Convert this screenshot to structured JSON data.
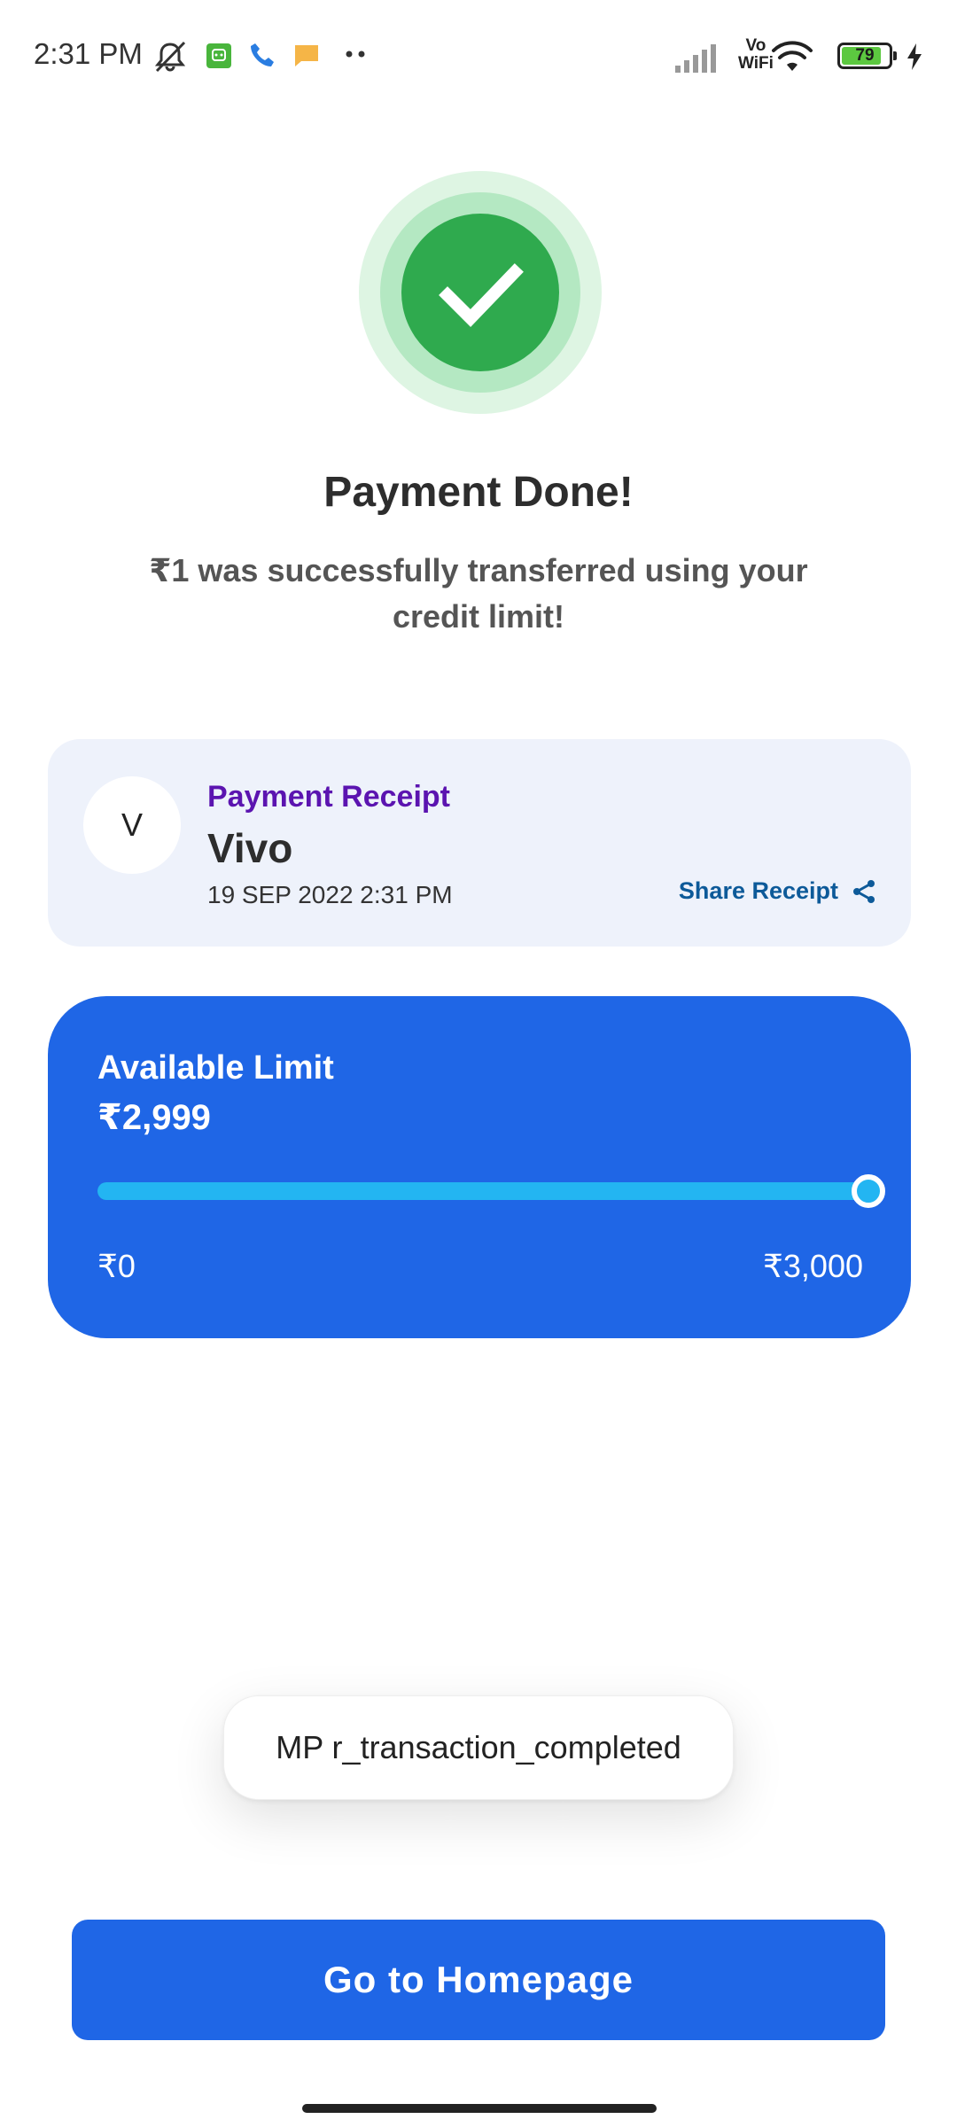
{
  "status_bar": {
    "time": "2:31 PM",
    "network": "Vo\nWiFi",
    "battery_level": "79",
    "icons": [
      "mute-icon",
      "app-notification-icon",
      "phone-icon",
      "message-icon",
      "more-dots-icon",
      "signal-icon",
      "wifi-icon",
      "battery-icon",
      "charging-icon"
    ]
  },
  "header": {
    "title": "Payment Done!",
    "subtitle": "₹1 was successfully transferred using your credit limit!"
  },
  "receipt": {
    "avatar_letter": "V",
    "label": "Payment Receipt",
    "merchant": "Vivo",
    "datetime": "19 SEP 2022 2:31 PM",
    "share_label": "Share Receipt"
  },
  "limit": {
    "label": "Available Limit",
    "value": "₹2,999",
    "min_label": "₹0",
    "max_label": "₹3,000",
    "fill_fraction": 0.9997
  },
  "toast": {
    "message": "MP r_transaction_completed"
  },
  "actions": {
    "home_label": "Go to Homepage"
  },
  "colors": {
    "primary": "#1f66e6",
    "success": "#2faa4e",
    "receipt_label": "#5b14b0",
    "share_link": "#0d5a99",
    "track_fill": "#23b5f2"
  }
}
